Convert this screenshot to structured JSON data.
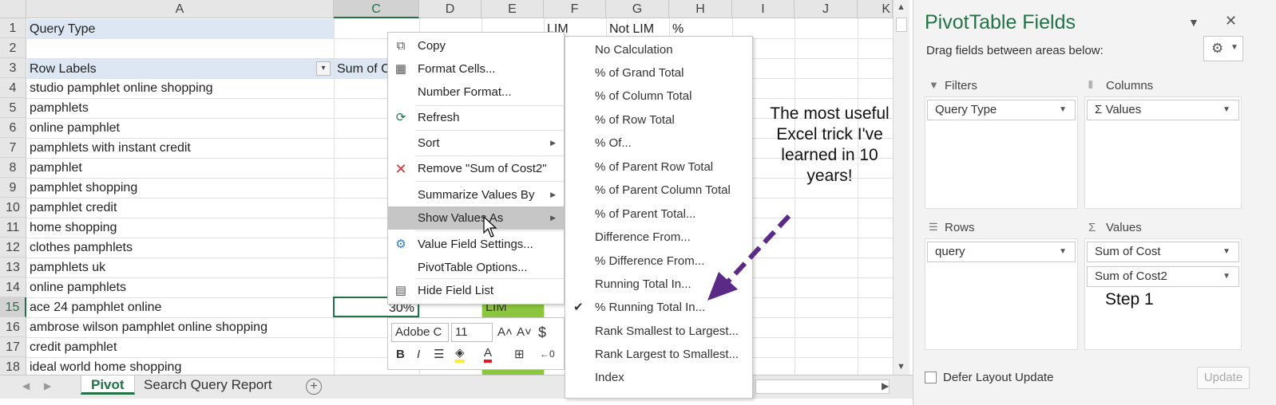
{
  "sheet": {
    "columns": [
      "A",
      "C",
      "D",
      "E",
      "F",
      "G",
      "H",
      "I",
      "J",
      "K"
    ],
    "rows": [
      "1",
      "2",
      "3",
      "4",
      "5",
      "6",
      "7",
      "8",
      "9",
      "10",
      "11",
      "12",
      "13",
      "14",
      "15",
      "16",
      "17",
      "18"
    ],
    "filter_label": "Query Type",
    "row_labels_header": "Row Labels",
    "sum_header": "Sum of C",
    "col_f_header": "LIM",
    "col_g_header": "Not LIM",
    "col_h_header": "%",
    "row_labels": [
      "studio pamphlet online shopping",
      "pamphlets",
      "online pamphlet",
      "pamphlets with instant credit",
      "pamphlet",
      "pamphlet shopping",
      "pamphlet credit",
      "home shopping",
      "clothes pamphlets",
      "pamphlets uk",
      "online pamphlets",
      "ace 24 pamphlet online",
      "ambrose wilson pamphlet online shopping",
      "credit pamphlet",
      "ideal world home shopping"
    ],
    "active_cell_value": "30%",
    "e15_value": "LIM",
    "tabs": [
      "Pivot",
      "Search Query Report"
    ],
    "add_sheet": "+"
  },
  "context_menu": {
    "items": [
      {
        "label": "Copy",
        "icon": "copy-icon"
      },
      {
        "label": "Format Cells...",
        "icon": "format-cells-icon"
      },
      {
        "label": "Number Format...",
        "icon": ""
      },
      {
        "label": "Refresh",
        "icon": "refresh-icon"
      },
      {
        "label": "Sort",
        "icon": "",
        "submenu": true
      },
      {
        "label": "Remove \"Sum of Cost2\"",
        "icon": "remove-x-icon"
      },
      {
        "label": "Summarize Values By",
        "icon": "",
        "submenu": true
      },
      {
        "label": "Show Values As",
        "icon": "",
        "submenu": true
      },
      {
        "label": "Value Field Settings...",
        "icon": "value-field-settings-icon"
      },
      {
        "label": "PivotTable Options...",
        "icon": ""
      },
      {
        "label": "Hide Field List",
        "icon": "field-list-icon"
      }
    ]
  },
  "mini_toolbar": {
    "font": "Adobe C",
    "size": "11",
    "grow": "A˄",
    "shrink": "A˅",
    "currency": "$",
    "bold": "B",
    "italic": "I"
  },
  "submenu": {
    "items": [
      {
        "label": "No Calculation",
        "checked": false
      },
      {
        "label": "% of Grand Total",
        "checked": false
      },
      {
        "label": "% of Column Total",
        "checked": false
      },
      {
        "label": "% of Row Total",
        "checked": false
      },
      {
        "label": "% Of...",
        "checked": false
      },
      {
        "label": "% of Parent Row Total",
        "checked": false
      },
      {
        "label": "% of Parent Column Total",
        "checked": false
      },
      {
        "label": "% of Parent Total...",
        "checked": false
      },
      {
        "label": "Difference From...",
        "checked": false
      },
      {
        "label": "% Difference From...",
        "checked": false
      },
      {
        "label": "Running Total In...",
        "checked": false
      },
      {
        "label": "% Running Total In...",
        "checked": true
      },
      {
        "label": "Rank Smallest to Largest...",
        "checked": false
      },
      {
        "label": "Rank Largest to Smallest...",
        "checked": false
      },
      {
        "label": "Index",
        "checked": false
      }
    ],
    "check_mark": "✔"
  },
  "annotation": {
    "note": "The most useful Excel trick I've learned in 10 years!",
    "step": "Step 1"
  },
  "pivot_pane": {
    "title": "PivotTable Fields",
    "subtitle": "Drag fields between areas below:",
    "filters_label": "Filters",
    "columns_label": "Columns",
    "rows_label": "Rows",
    "values_label": "Values",
    "filters_fields": [
      "Query Type"
    ],
    "columns_fields": [
      "Σ Values"
    ],
    "rows_fields": [
      "query"
    ],
    "values_fields": [
      "Sum of Cost",
      "Sum of Cost2"
    ],
    "defer_label": "Defer Layout Update",
    "update_label": "Update"
  },
  "colors": {
    "accent": "#217346",
    "arrow": "#5b2a86",
    "lim_green": "#8cc63f",
    "filter_blue": "#dde7f3"
  }
}
